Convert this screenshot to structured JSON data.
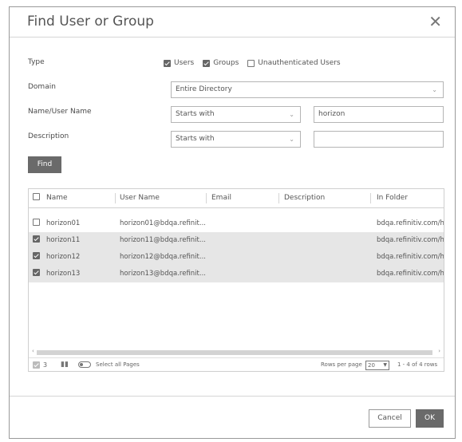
{
  "dialog": {
    "title": "Find User or Group",
    "close_glyph": "✕"
  },
  "form": {
    "type_label": "Type",
    "type_options": [
      {
        "label": "Users",
        "checked": true
      },
      {
        "label": "Groups",
        "checked": true
      },
      {
        "label": "Unauthenticated Users",
        "checked": false
      }
    ],
    "domain_label": "Domain",
    "domain_value": "Entire Directory",
    "name_label": "Name/User Name",
    "name_match": "Starts with",
    "name_value": "horizon",
    "description_label": "Description",
    "description_match": "Starts with",
    "description_value": "",
    "find_label": "Find"
  },
  "grid": {
    "columns": [
      "Name",
      "User Name",
      "Email",
      "Description",
      "In Folder"
    ],
    "rows": [
      {
        "checked": false,
        "selected": false,
        "name": "horizon01",
        "user_name": "horizon01@bdqa.refinit...",
        "email": "",
        "description": "",
        "in_folder": "bdqa.refinitiv.com/h"
      },
      {
        "checked": true,
        "selected": true,
        "name": "horizon11",
        "user_name": "horizon11@bdqa.refinit...",
        "email": "",
        "description": "",
        "in_folder": "bdqa.refinitiv.com/h"
      },
      {
        "checked": true,
        "selected": true,
        "name": "horizon12",
        "user_name": "horizon12@bdqa.refinit...",
        "email": "",
        "description": "",
        "in_folder": "bdqa.refinitiv.com/h"
      },
      {
        "checked": true,
        "selected": true,
        "name": "horizon13",
        "user_name": "horizon13@bdqa.refinit...",
        "email": "",
        "description": "",
        "in_folder": "bdqa.refinitiv.com/h"
      }
    ],
    "footer": {
      "selected_count": "3",
      "select_all_label": "Select all Pages",
      "rows_per_page_label": "Rows per page",
      "rows_per_page_value": "20",
      "range_text": "1 - 4 of 4 rows"
    }
  },
  "buttons": {
    "cancel": "Cancel",
    "ok": "OK"
  }
}
